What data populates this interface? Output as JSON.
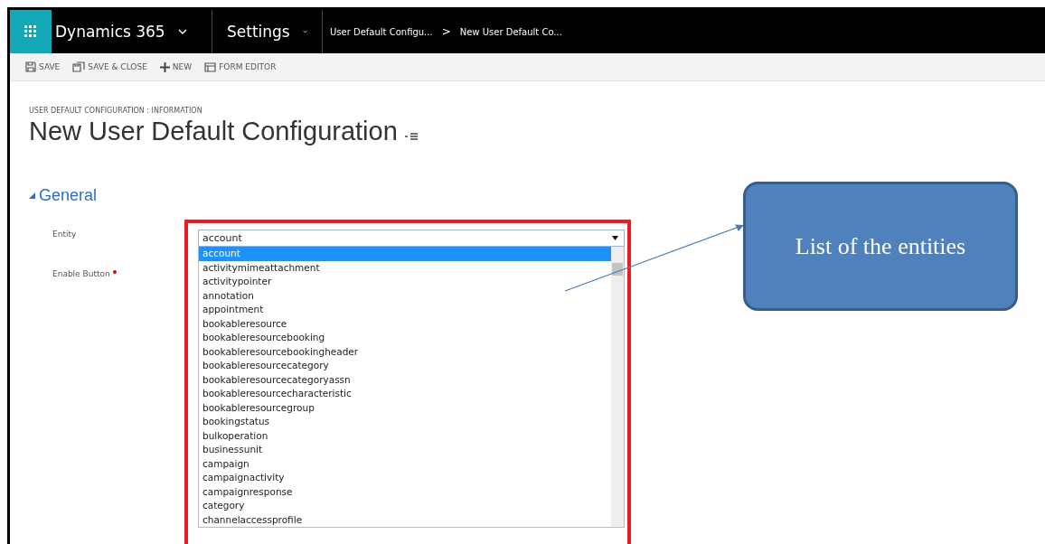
{
  "nav": {
    "app_name": "Dynamics 365",
    "area": "Settings",
    "breadcrumb": [
      "User Default Configu...",
      "New User Default Co..."
    ],
    "separator": ">"
  },
  "toolbar": [
    {
      "kind": "save",
      "label": "SAVE"
    },
    {
      "kind": "save-close",
      "label": "SAVE & CLOSE"
    },
    {
      "kind": "new",
      "label": "NEW"
    },
    {
      "kind": "form-editor",
      "label": "FORM EDITOR"
    }
  ],
  "header": {
    "entity_label": "USER DEFAULT CONFIGURATION : INFORMATION",
    "title": "New User Default Configuration"
  },
  "section": {
    "title": "General",
    "expanded": true
  },
  "fields": [
    {
      "label": "Entity",
      "required": false,
      "value": "account"
    },
    {
      "label": "Enable Button",
      "required": true
    }
  ],
  "dropdown_options": [
    {
      "label": "account",
      "selected": true
    },
    {
      "label": "activitymimeattachment",
      "selected": false
    },
    {
      "label": "activitypointer",
      "selected": false
    },
    {
      "label": "annotation",
      "selected": false
    },
    {
      "label": "appointment",
      "selected": false
    },
    {
      "label": "bookableresource",
      "selected": false
    },
    {
      "label": "bookableresourcebooking",
      "selected": false
    },
    {
      "label": "bookableresourcebookingheader",
      "selected": false
    },
    {
      "label": "bookableresourcecategory",
      "selected": false
    },
    {
      "label": "bookableresourcecategoryassn",
      "selected": false
    },
    {
      "label": "bookableresourcecharacteristic",
      "selected": false
    },
    {
      "label": "bookableresourcegroup",
      "selected": false
    },
    {
      "label": "bookingstatus",
      "selected": false
    },
    {
      "label": "bulkoperation",
      "selected": false
    },
    {
      "label": "businessunit",
      "selected": false
    },
    {
      "label": "campaign",
      "selected": false
    },
    {
      "label": "campaignactivity",
      "selected": false
    },
    {
      "label": "campaignresponse",
      "selected": false
    },
    {
      "label": "category",
      "selected": false
    },
    {
      "label": "channelaccessprofile",
      "selected": false
    }
  ],
  "callout": {
    "text": "List of the entities"
  }
}
